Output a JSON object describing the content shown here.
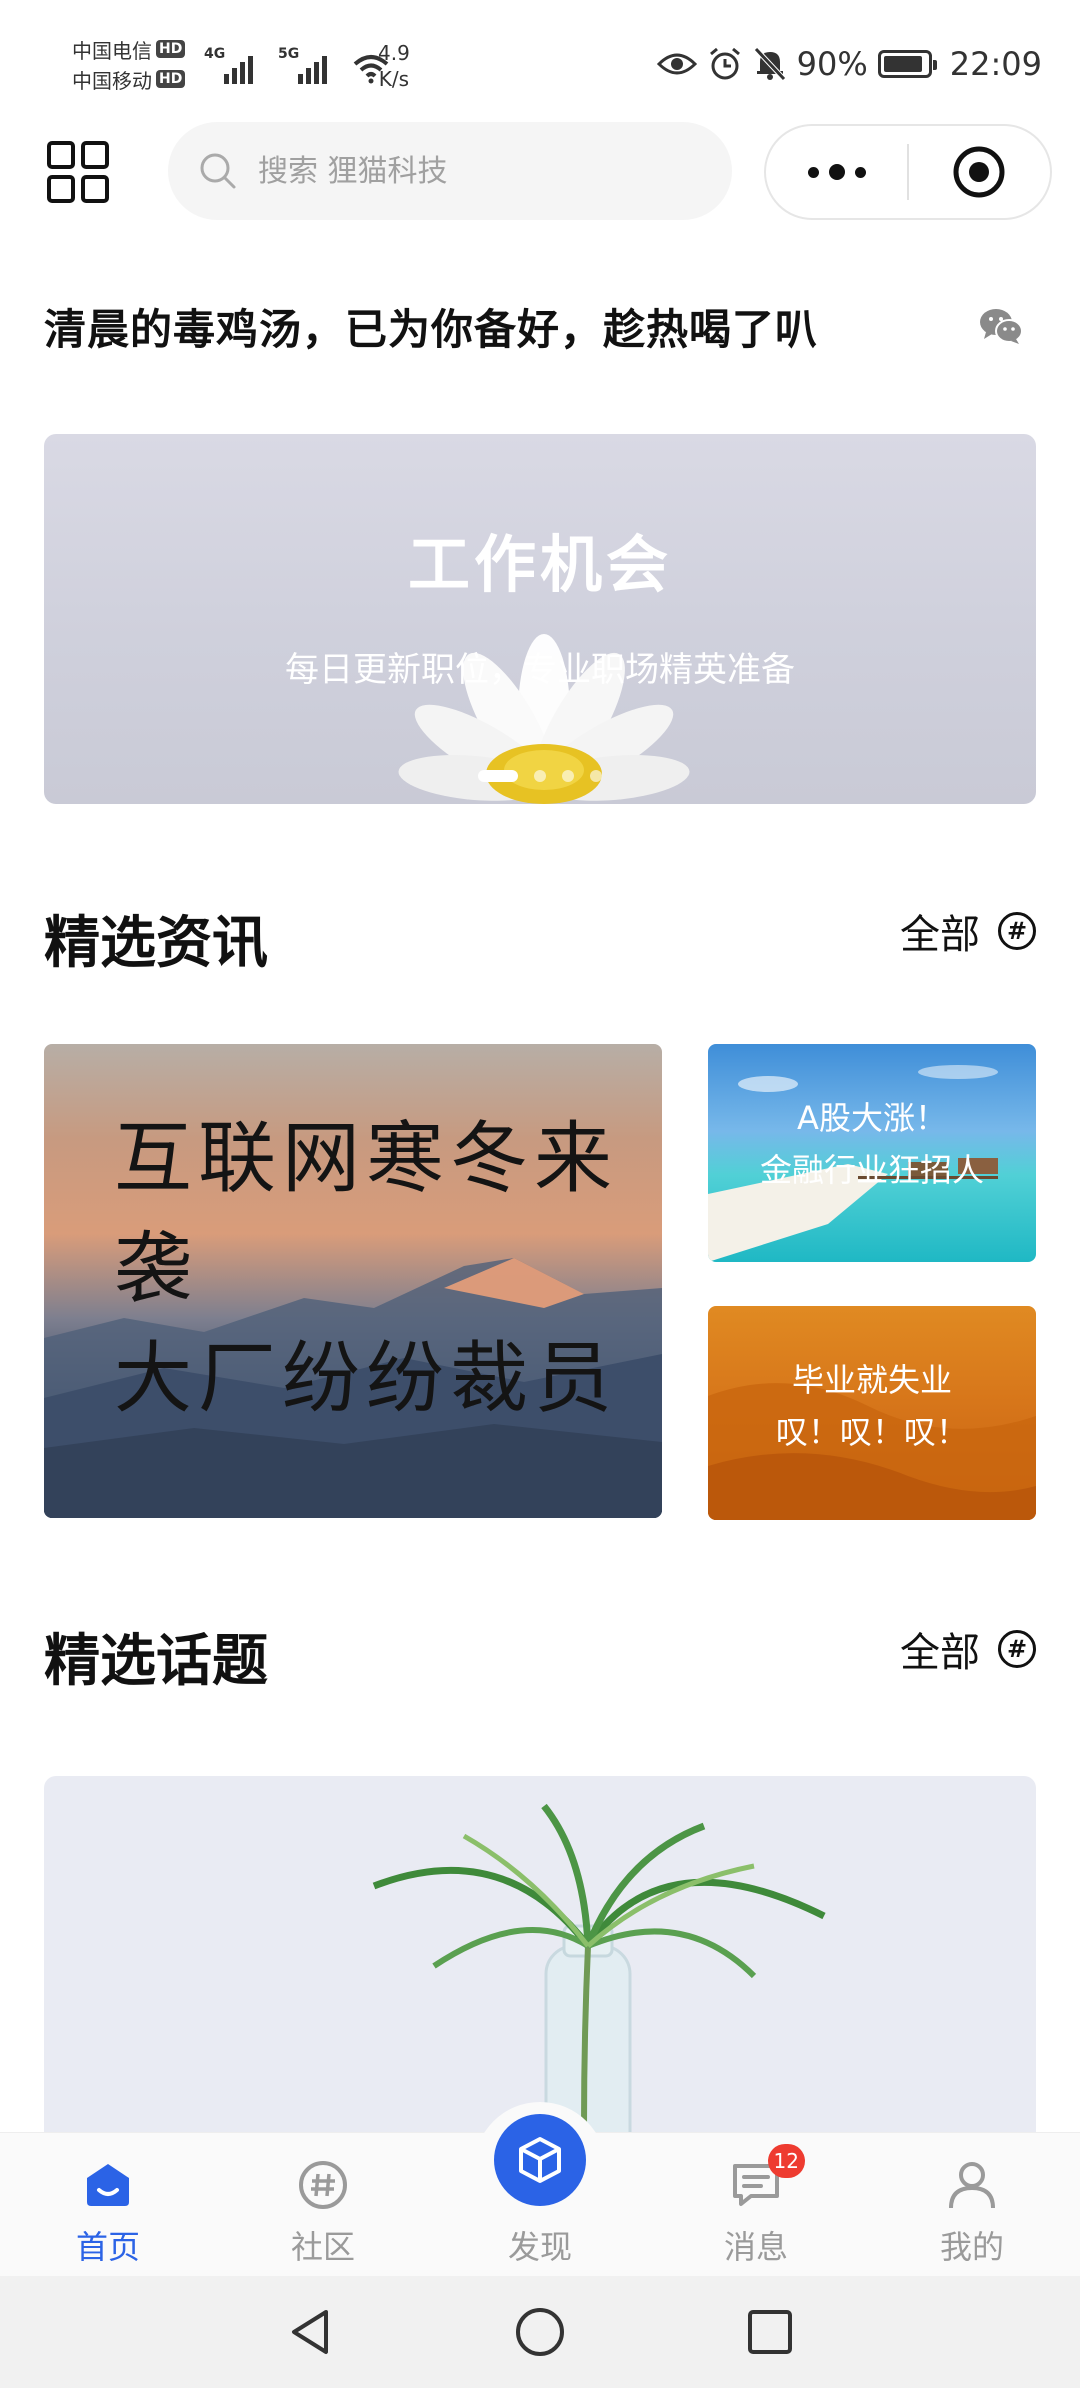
{
  "status_bar": {
    "carrier1": "中国电信",
    "carrier2": "中国移动",
    "hd": "HD",
    "net1": "4G",
    "net2": "5G",
    "speed_value": "4.9",
    "speed_unit": "K/s",
    "battery": "90%",
    "battery_level": 0.9,
    "time": "22:09"
  },
  "header": {
    "search_placeholder": "搜索 狸猫科技",
    "icons": [
      "grid-icon",
      "search-icon",
      "more-dots-icon",
      "close-target-icon"
    ]
  },
  "quote": {
    "text": "清晨的毒鸡汤，已为你备好，趁热喝了叭",
    "icon": "wechat-icon"
  },
  "banner": {
    "title": "工作机会",
    "subtitle": "每日更新职位，专业职场精英准备",
    "slides": 4,
    "active_slide": 0
  },
  "news_section": {
    "title": "精选资讯",
    "more_label": "全部",
    "cards": [
      {
        "line1": "互联网寒冬来袭",
        "line2": "大厂纷纷裁员"
      },
      {
        "line1": "A股大涨！",
        "line2": "金融行业狂招人"
      },
      {
        "line1": "毕业就失业",
        "line2": "叹！叹！叹！"
      }
    ]
  },
  "topics_section": {
    "title": "精选话题",
    "more_label": "全部"
  },
  "tabbar": {
    "items": [
      {
        "label": "首页",
        "icon": "home-icon",
        "active": true
      },
      {
        "label": "社区",
        "icon": "community-hash-icon",
        "active": false
      },
      {
        "label": "发现",
        "icon": "discover-cube-icon",
        "active": false
      },
      {
        "label": "消息",
        "icon": "message-icon",
        "active": false,
        "badge": "12"
      },
      {
        "label": "我的",
        "icon": "profile-icon",
        "active": false
      }
    ]
  },
  "colors": {
    "accent": "#2b63e6",
    "badge": "#ee3b30",
    "inactive_tab": "#9a9a9a"
  }
}
